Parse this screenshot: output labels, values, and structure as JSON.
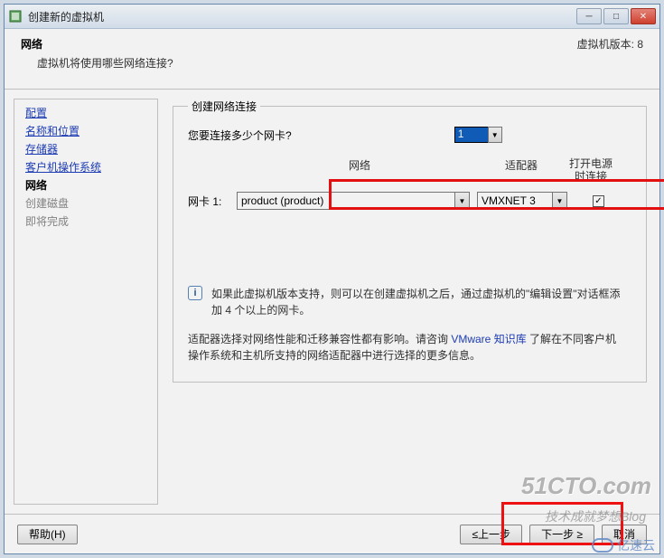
{
  "titlebar": {
    "title": "创建新的虚拟机"
  },
  "header": {
    "title": "网络",
    "subtitle": "虚拟机将使用哪些网络连接?",
    "version": "虚拟机版本: 8"
  },
  "sidebar": {
    "steps": [
      {
        "label": "配置",
        "kind": "link"
      },
      {
        "label": "名称和位置",
        "kind": "link"
      },
      {
        "label": "存储器",
        "kind": "link"
      },
      {
        "label": "客户机操作系统",
        "kind": "link"
      },
      {
        "label": "网络",
        "kind": "current"
      },
      {
        "label": "创建磁盘",
        "kind": "future"
      },
      {
        "label": "即将完成",
        "kind": "future"
      }
    ]
  },
  "main": {
    "group_legend": "创建网络连接",
    "question": "您要连接多少个网卡?",
    "count_value": "1",
    "columns": {
      "network": "网络",
      "adapter": "适配器",
      "connect": "打开电源时连接"
    },
    "nic": {
      "label": "网卡 1:",
      "network_value": "product (product)",
      "adapter_value": "VMXNET 3",
      "connect_checked": "✓"
    },
    "info1": "如果此虚拟机版本支持，则可以在创建虚拟机之后，通过虚拟机的\"编辑设置\"对话框添加 4 个以上的网卡。",
    "info2_a": "适配器选择对网络性能和迁移兼容性都有影响。请咨询 ",
    "info2_link": "VMware 知识库",
    "info2_b": " 了解在不同客户机操作系统和主机所支持的网络适配器中进行选择的更多信息。"
  },
  "footer": {
    "help": "帮助(H)",
    "back": "≤上一步",
    "next": "下一步 ≥",
    "cancel": "取消"
  },
  "watermarks": {
    "w1": "51CTO.com",
    "w2": "技术成就梦想Blog",
    "w3": "亿速云"
  }
}
